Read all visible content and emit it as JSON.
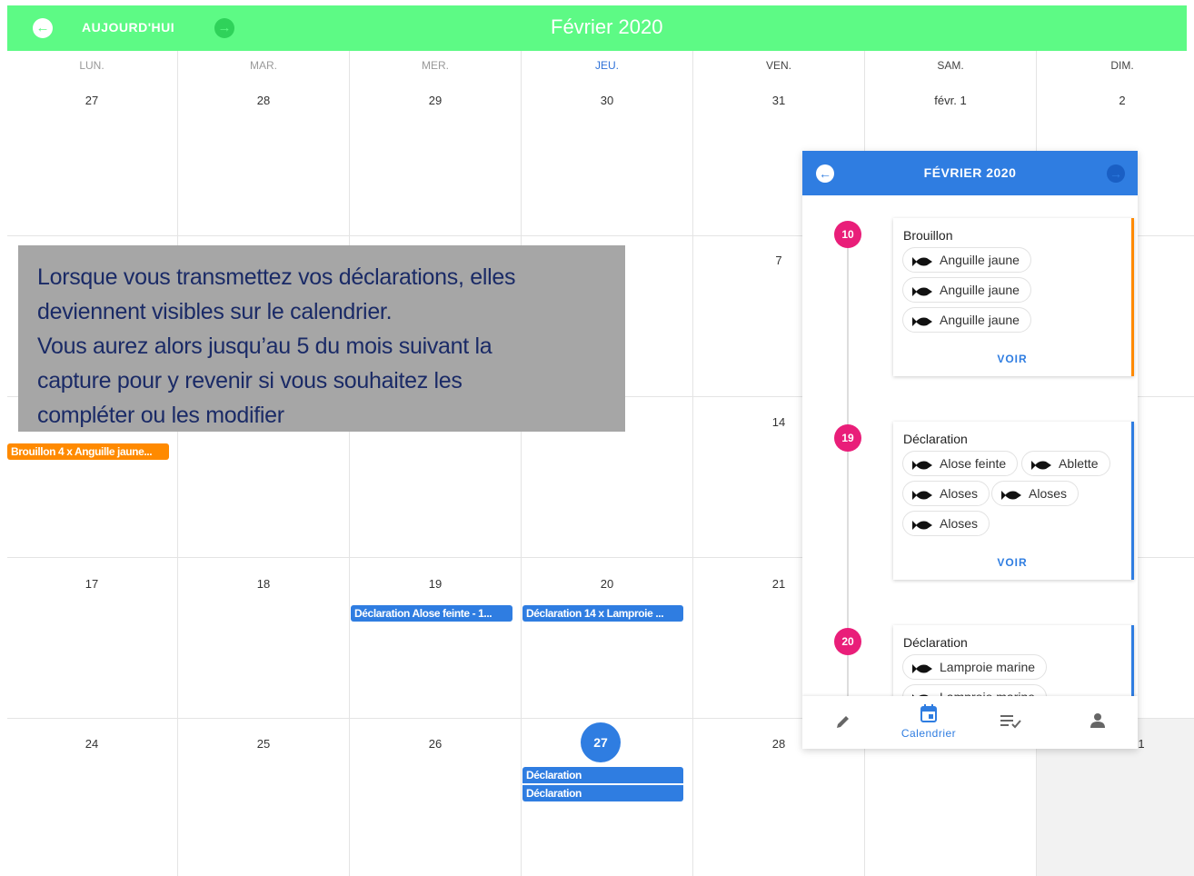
{
  "header": {
    "today_label": "AUJOURD'HUI",
    "month_title": "Février 2020",
    "prev_icon": "arrow-left-circle-icon",
    "next_icon": "arrow-right-circle-icon",
    "accent_color": "#5dfa85"
  },
  "weekdays": [
    "LUN.",
    "MAR.",
    "MER.",
    "JEU.",
    "VEN.",
    "SAM.",
    "DIM."
  ],
  "weeks": [
    [
      "27",
      "28",
      "29",
      "30",
      "31",
      "févr. 1",
      "2"
    ],
    [
      "7"
    ],
    [
      "14"
    ],
    [
      "17",
      "18",
      "19",
      "20",
      "21"
    ],
    [
      "24",
      "25",
      "26",
      "27",
      "28",
      "1"
    ]
  ],
  "events": [
    {
      "label": "Brouillon 4 x Anguille jaune...",
      "color": "#ff8a00"
    },
    {
      "label": "Déclaration Alose feinte - 1...",
      "color": "#2f7de1"
    },
    {
      "label": "Déclaration 14 x Lamproie ...",
      "color": "#2f7de1"
    },
    {
      "label": "Déclaration",
      "color": "#2f7de1"
    },
    {
      "label": "Déclaration",
      "color": "#2f7de1"
    }
  ],
  "overlay": {
    "lines": [
      "Lorsque vous transmettez vos déclarations, elles",
      "deviennent visibles sur le calendrier.",
      "Vous aurez alors jusqu’au 5 du mois suivant la",
      "capture pour y revenir si vous souhaitez les",
      "compléter ou les modifier"
    ]
  },
  "panel": {
    "title": "FÉVRIER 2020",
    "color": "#2f7de1",
    "entries": [
      {
        "day": "10",
        "title": "Brouillon",
        "status_color": "#ff8a00",
        "chips": [
          "Anguille jaune",
          "Anguille jaune",
          "Anguille jaune"
        ],
        "action": "VOIR"
      },
      {
        "day": "19",
        "title": "Déclaration",
        "status_color": "#2f7de1",
        "chips": [
          "Alose feinte",
          "Ablette",
          "Aloses",
          "Aloses",
          "Aloses"
        ],
        "action": "VOIR"
      },
      {
        "day": "20",
        "title": "Déclaration",
        "status_color": "#2f7de1",
        "chips": [
          "Lamproie marine",
          "Lamproie marine"
        ]
      }
    ],
    "bottom_nav": {
      "items": [
        "pencil-icon",
        "calendar-icon",
        "checklist-icon",
        "person-icon"
      ],
      "active_label": "Calendrier"
    }
  }
}
